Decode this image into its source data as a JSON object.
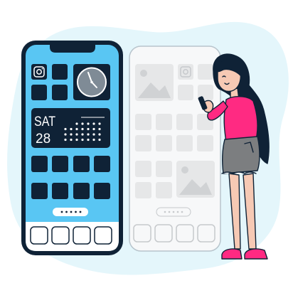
{
  "colors": {
    "blob": "#e4f6fb",
    "phone_frame": "#0f2236",
    "screen": "#59c6f3",
    "tile": "#0f2236",
    "ghost_tile": "#e6e7e8",
    "ghost_outline": "#b8c4cc",
    "shirt": "#ff2a82",
    "skirt": "#7c7e80",
    "shoes": "#ff2a82",
    "hair": "#0f2236",
    "skin": "#f6c9b4"
  },
  "widget": {
    "day": "SAT",
    "date": "28"
  },
  "icons": {
    "camera": "instagram-camera-icon",
    "clock": "analog-clock-icon",
    "photo": "photo-placeholder-icon",
    "calendar": "calendar-dots-icon"
  },
  "pager": {
    "dots": 5,
    "active": 0
  }
}
